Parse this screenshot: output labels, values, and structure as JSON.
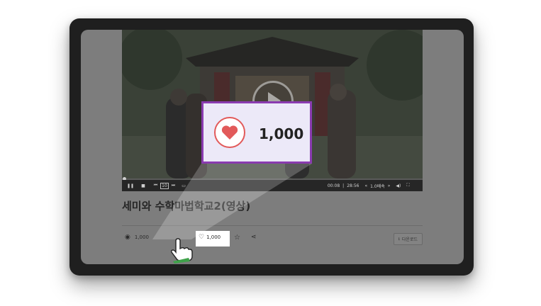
{
  "video": {
    "time_current": "00:08",
    "time_total": "28:56",
    "speed": "1.0배속",
    "skip_label": "10"
  },
  "title": "세미와 수학마법학교2(영상)",
  "stats": {
    "views": "1,000",
    "likes": "1,000"
  },
  "download_label": "다운로드",
  "zoom": {
    "count": "1,000"
  },
  "colors": {
    "zoom_border": "#8a3bb0",
    "heart": "#e25a5a",
    "cursor_accent": "#3fa24a"
  }
}
